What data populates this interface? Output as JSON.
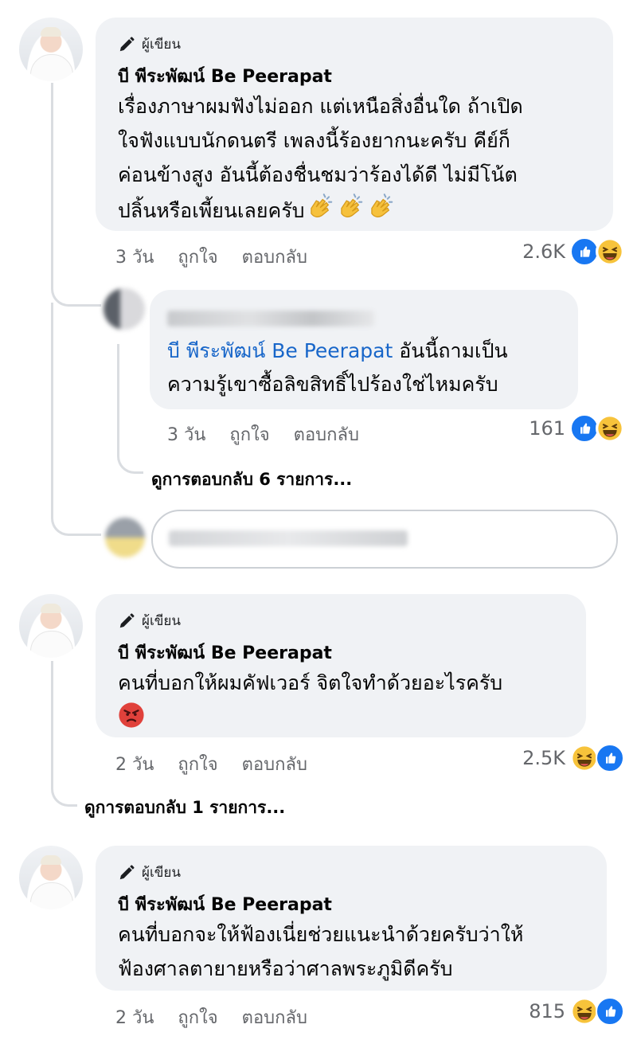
{
  "comments": [
    {
      "author_badge": "ผู้เขียน",
      "name": "บี พีระพัฒน์ Be Peerapat",
      "lines": [
        "เรื่องภาษาผมฟังไม่ออก แต่เหนือสิ่งอื่นใด ถ้าเปิด",
        "ใจฟังแบบนักดนตรี เพลงนี้ร้องยากนะครับ คีย์ก็",
        "ค่อนข้างสูง อันนี้ต้องชื่นชมว่าร้องได้ดี ไม่มีโน้ต",
        "ปลิ้นหรือเพี้ยนเลยครับ"
      ],
      "emoji": "clap-emoji",
      "time": "3 วัน",
      "like": "ถูกใจ",
      "reply": "ตอบกลับ",
      "count": "2.6K",
      "reactions": [
        "like",
        "haha"
      ]
    },
    {
      "author_badge": "ผู้เขียน",
      "name": "บี พีระพัฒน์ Be Peerapat",
      "lines": [
        "คนที่บอกให้ผมคัฟเวอร์ จิตใจทำด้วยอะไรครับ"
      ],
      "emoji": "angry-emoji",
      "time": "2 วัน",
      "like": "ถูกใจ",
      "reply": "ตอบกลับ",
      "count": "2.5K",
      "reactions": [
        "haha",
        "like"
      ]
    },
    {
      "author_badge": "ผู้เขียน",
      "name": "บี พีระพัฒน์ Be Peerapat",
      "lines": [
        "คนที่บอกจะให้ฟ้องเนี่ยช่วยแนะนำด้วยครับว่าให้",
        "ฟ้องศาลตายายหรือว่าศาลพระภูมิดีครับ"
      ],
      "time": "2 วัน",
      "like": "ถูกใจ",
      "reply": "ตอบกลับ",
      "count": "815",
      "reactions": [
        "haha",
        "like"
      ]
    }
  ],
  "reply": {
    "mention": "บี พีระพัฒน์ Be Peerapat",
    "line1_rest": " อันนี้ถามเป็น",
    "line2": "ความรู้เขาซื้อลิขสิทธิ์ไปร้องใช่ไหมครับ",
    "time": "3 วัน",
    "like": "ถูกใจ",
    "reply": "ตอบกลับ",
    "count": "161",
    "reactions": [
      "like",
      "haha"
    ]
  },
  "view_more_1": "ดูการตอบกลับ 6 รายการ...",
  "view_more_2": "ดูการตอบกลับ 1 รายการ...",
  "colors": {
    "like_blue": "#1877f2",
    "haha_yellow": "#f7c33b",
    "angry_red": "#e0413b",
    "mention_blue": "#1866c9",
    "bubble_bg": "#f0f2f5",
    "meta_gray": "#65676b"
  }
}
